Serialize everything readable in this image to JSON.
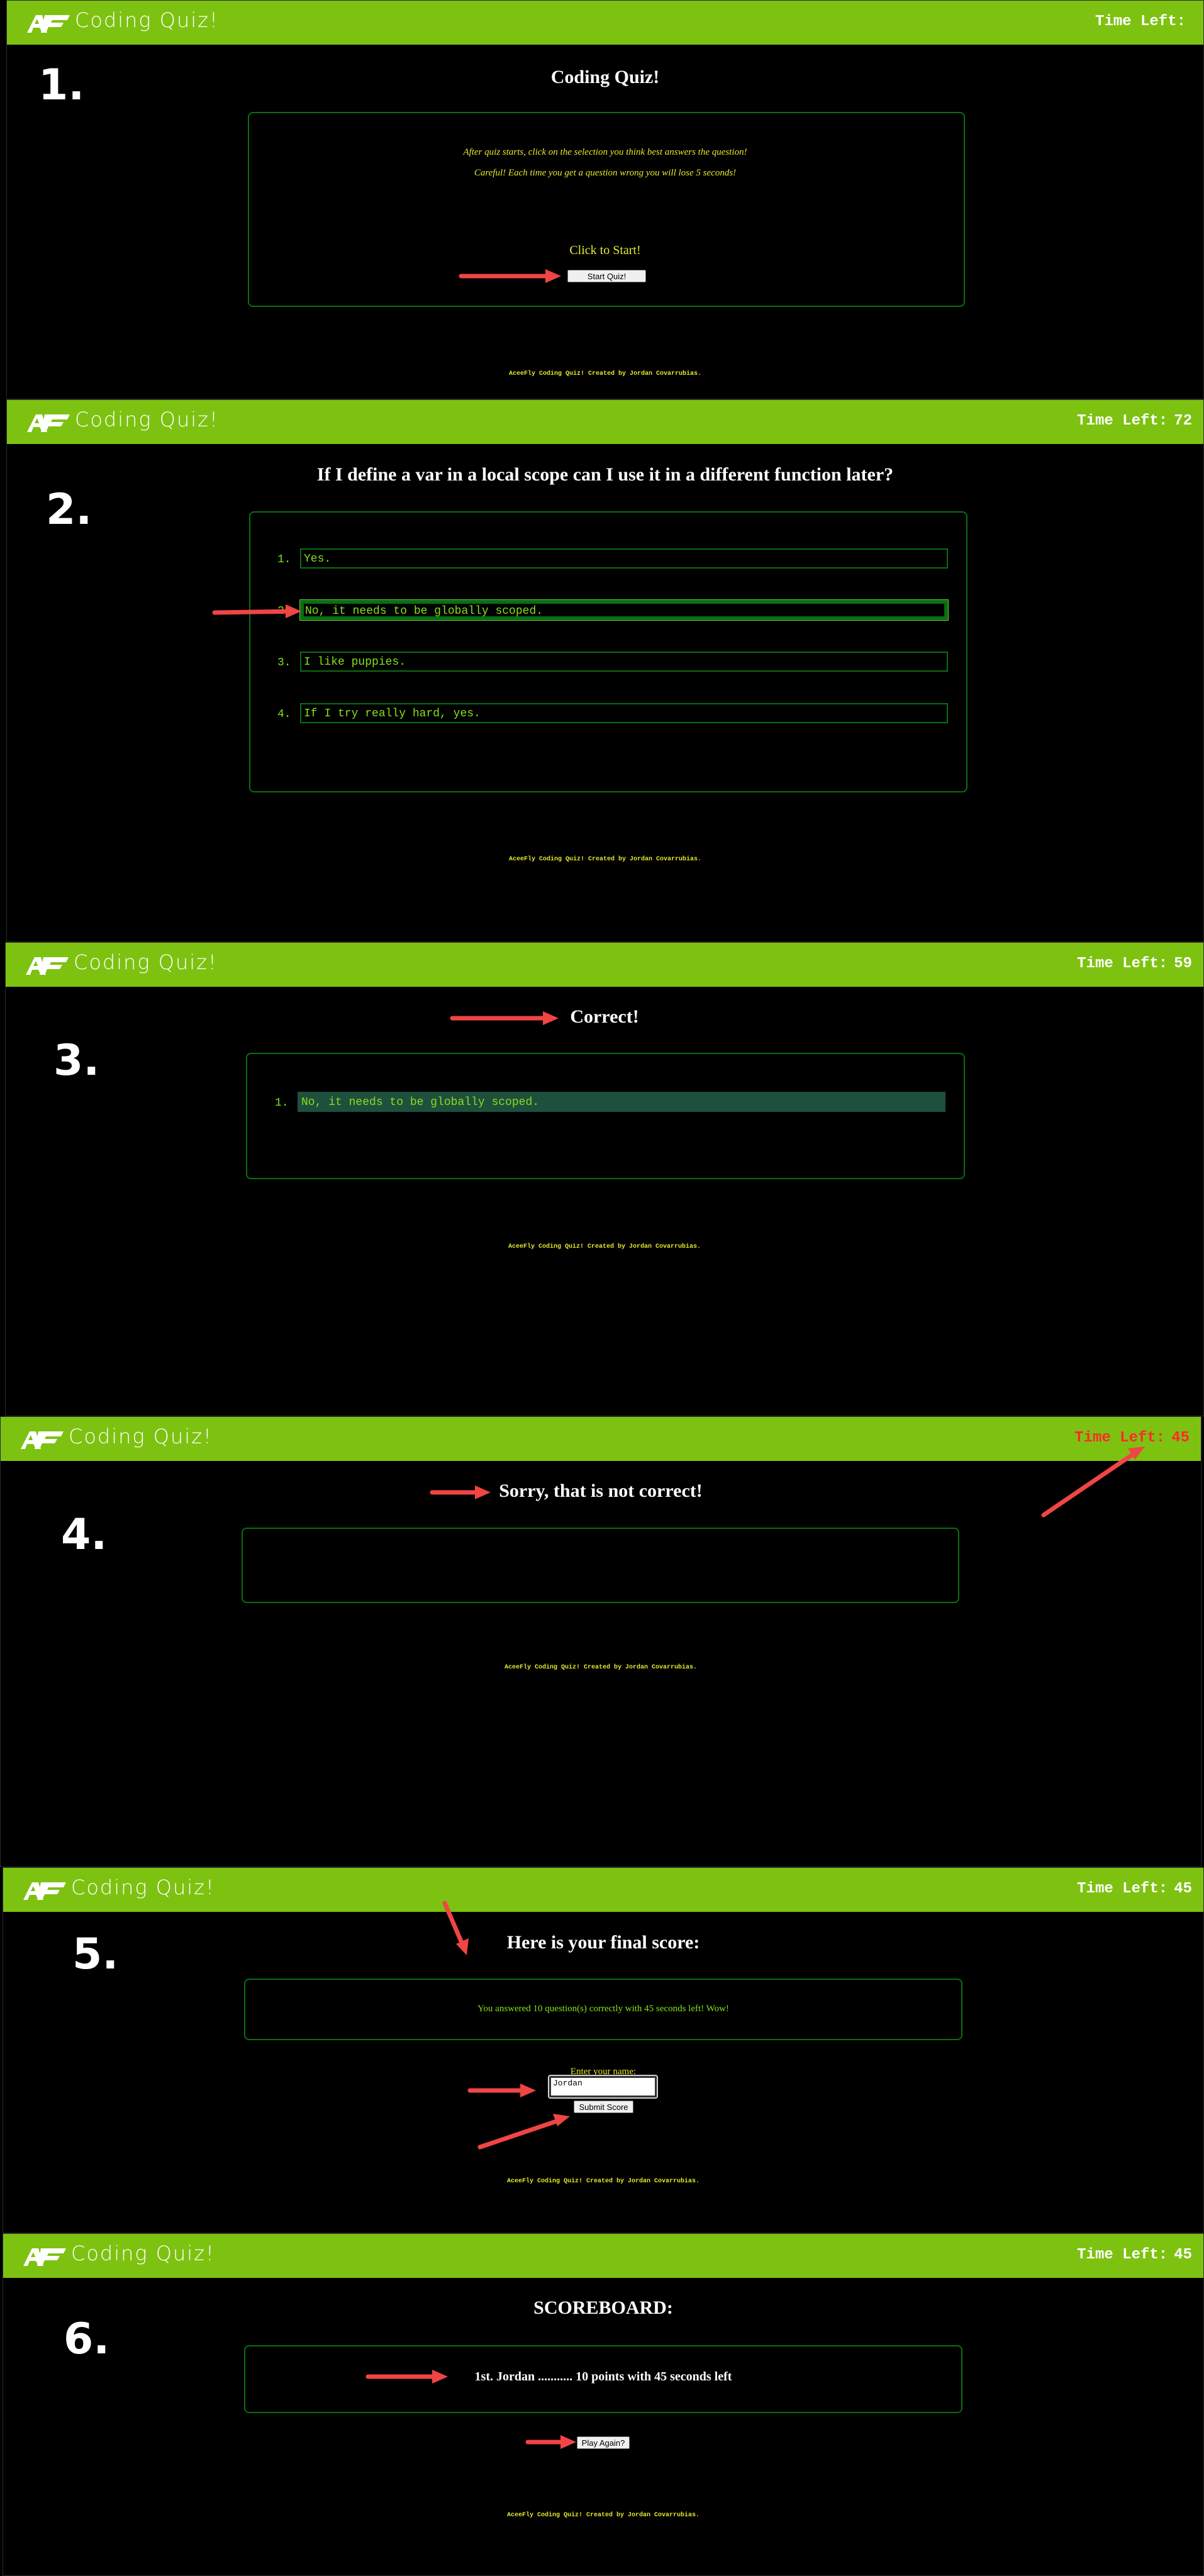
{
  "app": {
    "brand_title": "Coding Quiz!",
    "timer_label": "Time Left:",
    "footer": "AceeFly Coding Quiz! Created by Jordan Covarrubias."
  },
  "colors": {
    "header": "#7dc211",
    "accent_text": "#84e01a",
    "footer_text": "#e6ea2b",
    "box_border": "#0a6e12",
    "timer_alert": "#ff2a2a",
    "arrow": "#f04545"
  },
  "steps": [
    {
      "number": "1.",
      "timer_value": "",
      "title": "Coding Quiz!",
      "instructions": [
        "After quiz starts, click on the selection you think best answers the question!",
        "Careful! Each time you get a question wrong you will lose 5 seconds!"
      ],
      "start_label": "Click to Start!",
      "start_button": "Start Quiz!"
    },
    {
      "number": "2.",
      "timer_value": "72",
      "title": "If I define a var in a local scope can I use it in a different function later?",
      "answers": [
        {
          "num": "1.",
          "text": "Yes."
        },
        {
          "num": "2.",
          "text": "No, it needs to be globally scoped."
        },
        {
          "num": "3.",
          "text": "I like puppies."
        },
        {
          "num": "4.",
          "text": "If I try really hard, yes."
        }
      ]
    },
    {
      "number": "3.",
      "timer_value": "59",
      "title": "Correct!",
      "answers": [
        {
          "num": "1.",
          "text": "No, it needs to be globally scoped."
        }
      ]
    },
    {
      "number": "4.",
      "timer_value": "45",
      "title": "Sorry, that is not correct!"
    },
    {
      "number": "5.",
      "timer_value": "45",
      "title": "Here is your final score:",
      "result": "You answered 10 question(s) correctly with 45 seconds left! Wow!",
      "name_label": "Enter your name:",
      "name_value": "Jordan",
      "submit_button": "Submit Score"
    },
    {
      "number": "6.",
      "timer_value": "45",
      "title": "SCOREBOARD:",
      "scores": [
        {
          "entry": "1st. Jordan ........... 10 points with 45 seconds left"
        }
      ],
      "play_again_button": "Play Again?"
    }
  ]
}
